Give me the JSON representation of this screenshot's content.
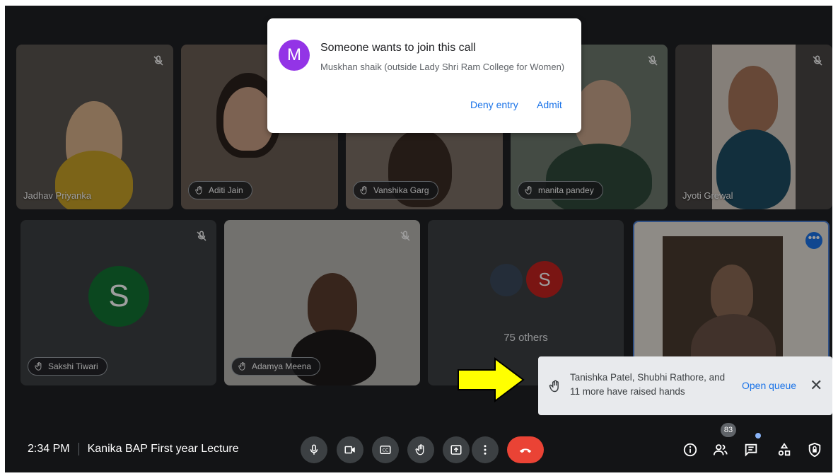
{
  "participants": [
    {
      "name": "Jadhav Priyanka"
    },
    {
      "name": "Aditi Jain"
    },
    {
      "name": "Vanshika Garg"
    },
    {
      "name": "manita pandey"
    },
    {
      "name": "Jyoti Grewal"
    },
    {
      "name": "Sakshi Tiwari",
      "initial": "S"
    },
    {
      "name": "Adamya Meena"
    }
  ],
  "others": {
    "initial": "S",
    "label": "75 others"
  },
  "join_dialog": {
    "initial": "M",
    "title": "Someone wants to join this call",
    "subtitle": "Muskhan shaik (outside Lady Shri Ram College for Women)",
    "deny_label": "Deny entry",
    "admit_label": "Admit"
  },
  "hands_toast": {
    "text": "Tanishka Patel, Shubhi Rathore, and 11 more have raised hands",
    "open_queue_label": "Open queue",
    "close_label": "✕"
  },
  "bottom_bar": {
    "time": "2:34 PM",
    "meeting_title": "Kanika BAP First year Lecture",
    "people_count": "83"
  },
  "colors": {
    "end_call": "#ea4335",
    "accent": "#1a73e8",
    "dialog_avatar": "#9334e6",
    "sakshi_avatar": "#137333",
    "others_avatar": "#c5221f",
    "arrow": "#ffff00"
  }
}
